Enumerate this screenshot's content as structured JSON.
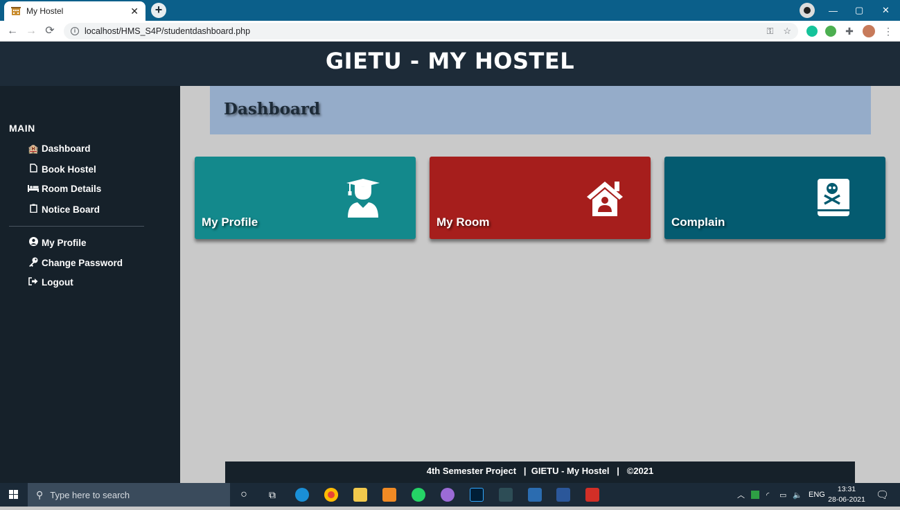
{
  "browser": {
    "tab_title": "My Hostel",
    "tab_close": "✕",
    "new_tab": "+",
    "url": "localhost/HMS_S4P/studentdashboard.php",
    "window_controls": [
      "—",
      "▢",
      "✕"
    ]
  },
  "header": {
    "title": "GIETU - MY HOSTEL"
  },
  "sidebar": {
    "heading": "MAIN",
    "items": [
      {
        "label": "Dashboard",
        "icon": "hotel-icon"
      },
      {
        "label": "Book Hostel",
        "icon": "file-icon"
      },
      {
        "label": "Room Details",
        "icon": "bed-icon"
      },
      {
        "label": "Notice Board",
        "icon": "clipboard-icon"
      }
    ],
    "account_items": [
      {
        "label": "My Profile",
        "icon": "user-circle-icon"
      },
      {
        "label": "Change Password",
        "icon": "key-icon"
      },
      {
        "label": "Logout",
        "icon": "sign-out-icon"
      }
    ]
  },
  "main": {
    "banner_title": "Dashboard",
    "cards": [
      {
        "label": "My Profile",
        "icon": "graduate-icon",
        "color": "#13898c"
      },
      {
        "label": "My Room",
        "icon": "house-user-icon",
        "color": "#a61e1c"
      },
      {
        "label": "Complain",
        "icon": "poison-book-icon",
        "color": "#045b70"
      }
    ]
  },
  "footer": {
    "text": "4th Semester Project   |  GIETU - My Hostel   |   ©2021"
  },
  "taskbar": {
    "search_placeholder": "Type here to search",
    "language": "ENG",
    "time": "13:31",
    "date": "28-06-2021"
  }
}
